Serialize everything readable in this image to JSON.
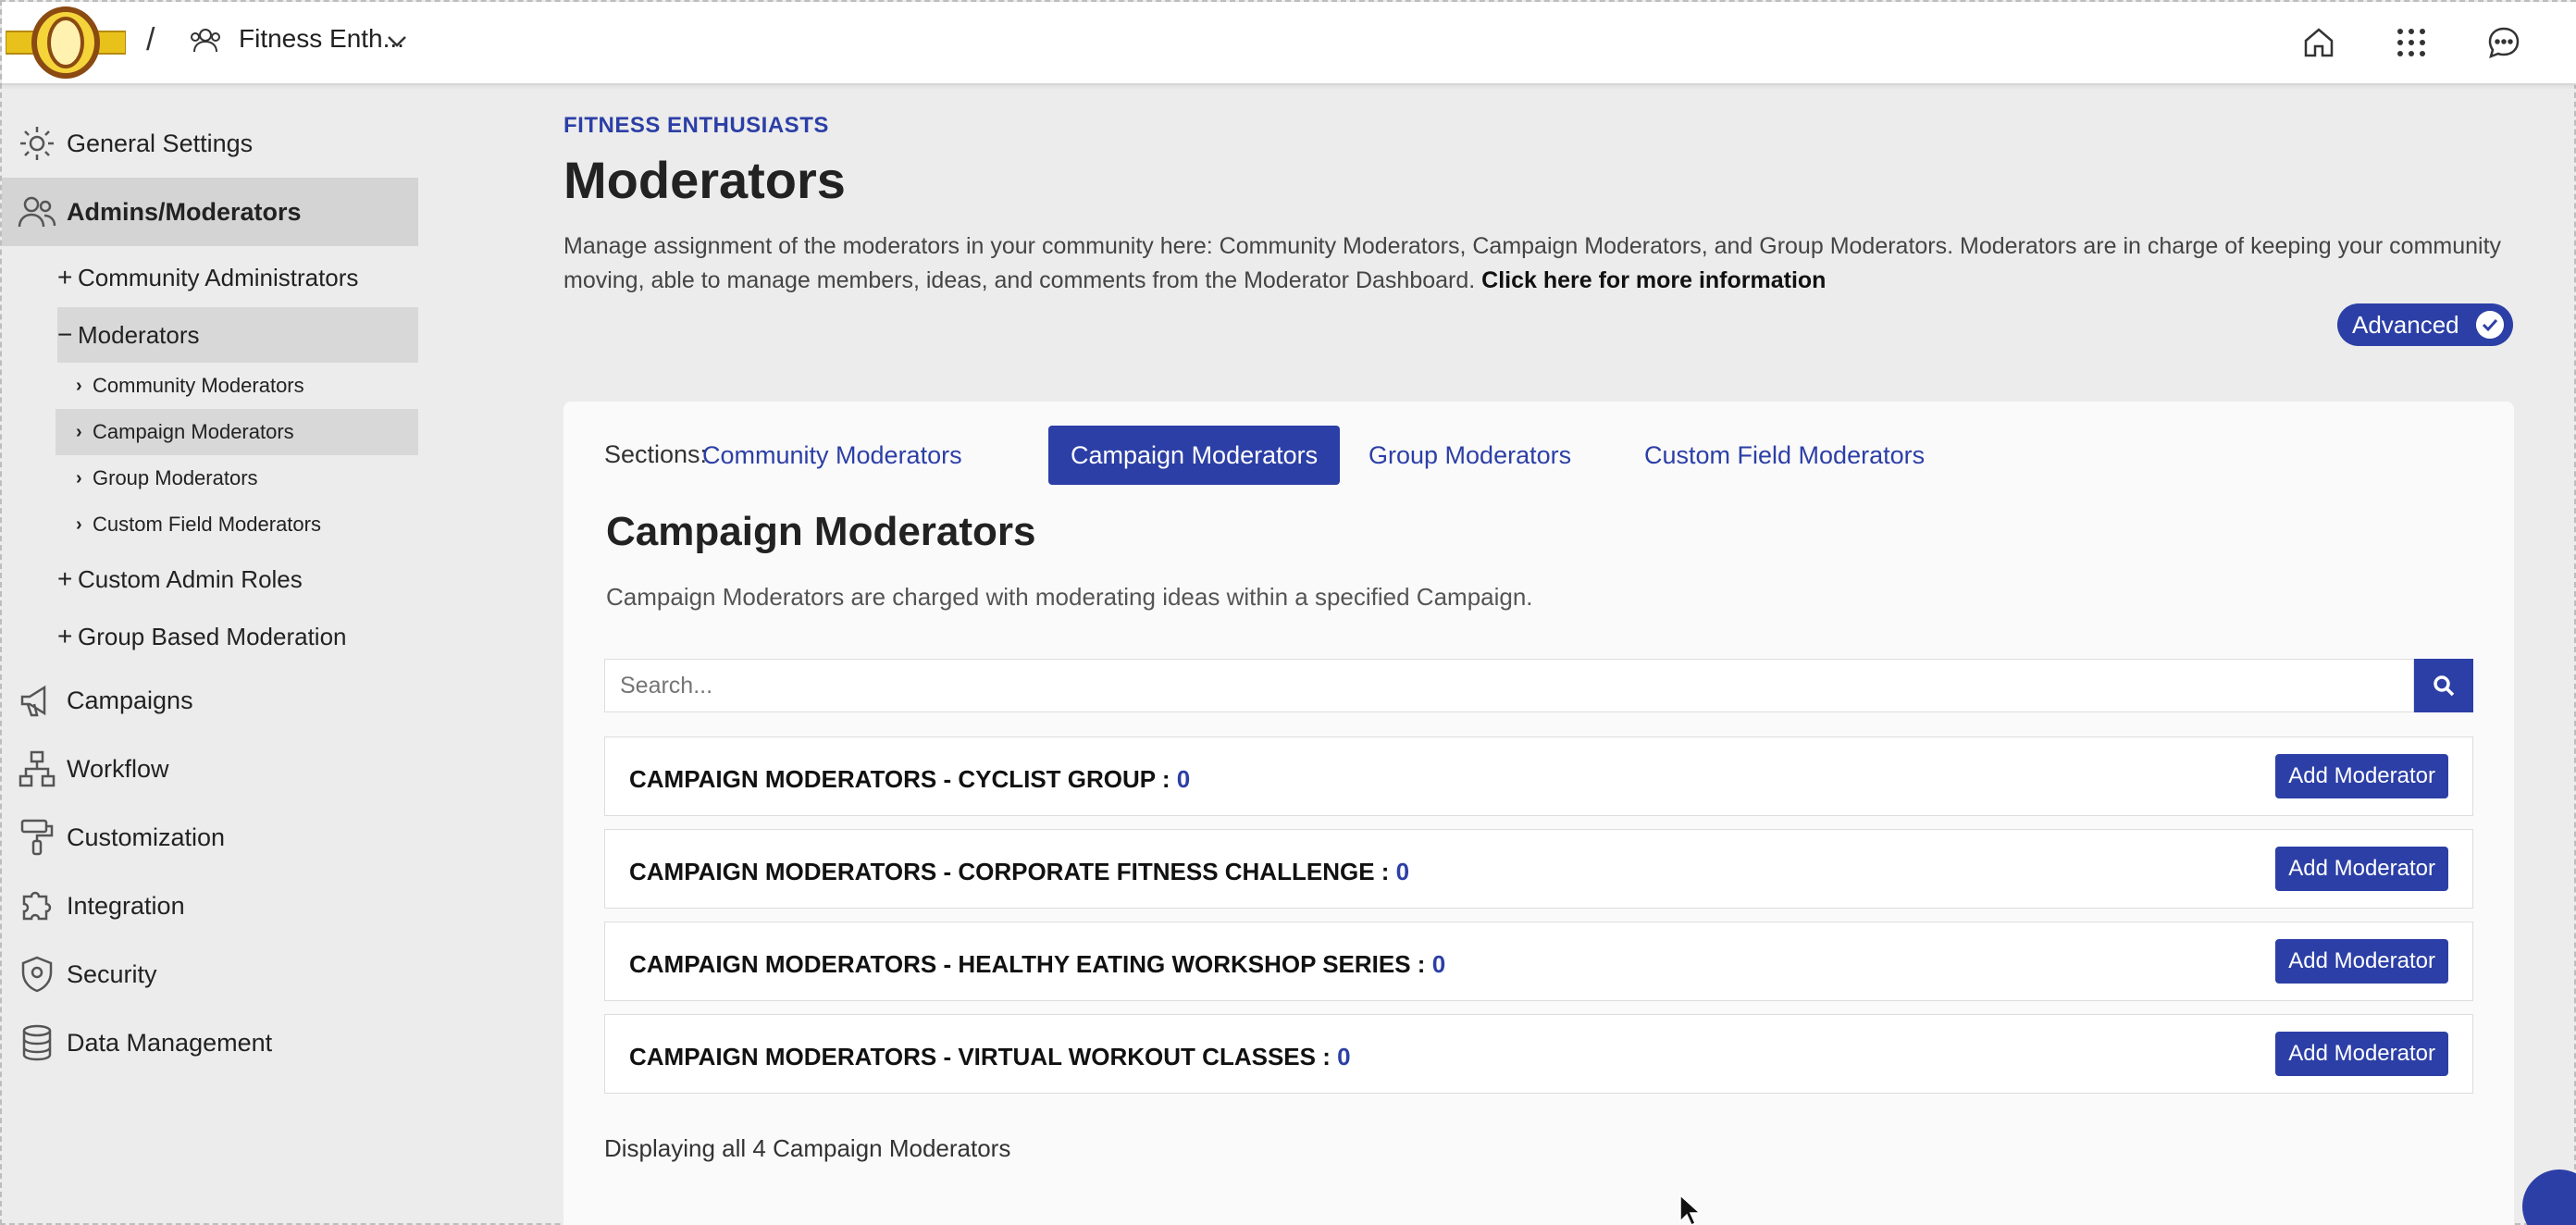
{
  "header": {
    "breadcrumb_separator": "/",
    "community_name": "Fitness Enth..."
  },
  "sidebar": {
    "items": [
      {
        "label": "General Settings",
        "icon": "gear-icon"
      },
      {
        "label": "Admins/Moderators",
        "icon": "users-icon"
      },
      {
        "label": "Community Administrators",
        "sym": "+"
      },
      {
        "label": "Moderators",
        "sym": "−"
      },
      {
        "label": "Community Moderators",
        "sym": "›"
      },
      {
        "label": "Campaign Moderators",
        "sym": "›"
      },
      {
        "label": "Group Moderators",
        "sym": "›"
      },
      {
        "label": "Custom Field Moderators",
        "sym": "›"
      },
      {
        "label": "Custom Admin Roles",
        "sym": "+"
      },
      {
        "label": "Group Based Moderation",
        "sym": "+"
      },
      {
        "label": "Campaigns",
        "icon": "megaphone-icon"
      },
      {
        "label": "Workflow",
        "icon": "workflow-icon"
      },
      {
        "label": "Customization",
        "icon": "paintbrush-icon"
      },
      {
        "label": "Integration",
        "icon": "puzzle-icon"
      },
      {
        "label": "Security",
        "icon": "shield-icon"
      },
      {
        "label": "Data Management",
        "icon": "database-icon"
      }
    ]
  },
  "main": {
    "eyebrow": "FITNESS ENTHUSIASTS",
    "title": "Moderators",
    "description": "Manage assignment of the moderators in your community here: Community Moderators, Campaign Moderators, and Group Moderators. Moderators are in charge of keeping your community moving, able to manage members, ideas, and comments from the Moderator Dashboard. ",
    "more_link": "Click here for more information",
    "advanced_label": "Advanced"
  },
  "sections": {
    "label": "Sections:",
    "tabs": [
      {
        "label": "Community Moderators"
      },
      {
        "label": "Campaign Moderators"
      },
      {
        "label": "Group Moderators"
      },
      {
        "label": "Custom Field Moderators"
      }
    ]
  },
  "panel": {
    "title": "Campaign Moderators",
    "description": "Campaign Moderators are charged with moderating ideas within a specified Campaign.",
    "search_placeholder": "Search...",
    "rows": [
      {
        "label": "CAMPAIGN MODERATORS - CYCLIST GROUP : ",
        "count": "0",
        "button": "Add Moderator"
      },
      {
        "label": "CAMPAIGN MODERATORS - CORPORATE FITNESS CHALLENGE : ",
        "count": "0",
        "button": "Add Moderator"
      },
      {
        "label": "CAMPAIGN MODERATORS - HEALTHY EATING WORKSHOP SERIES : ",
        "count": "0",
        "button": "Add Moderator"
      },
      {
        "label": "CAMPAIGN MODERATORS - VIRTUAL WORKOUT CLASSES : ",
        "count": "0",
        "button": "Add Moderator"
      }
    ],
    "footer": "Displaying all 4 Campaign Moderators"
  },
  "colors": {
    "accent": "#2c3fa6",
    "active_bg": "#d4d4d4",
    "background": "#ececec"
  }
}
